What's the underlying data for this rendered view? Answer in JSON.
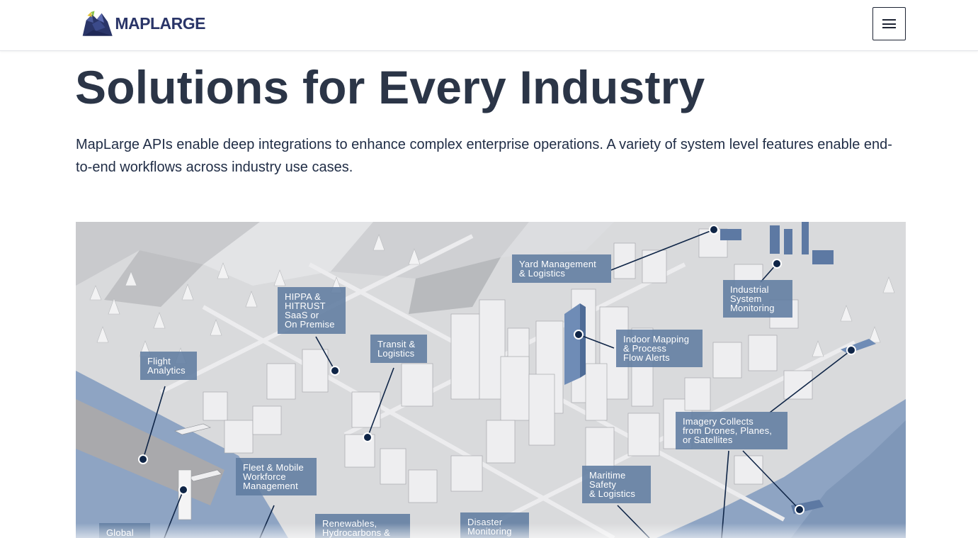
{
  "header": {
    "logo_text": "MAPLARGE",
    "menu_icon": "hamburger-menu-icon"
  },
  "main": {
    "title": "Solutions for Every Industry",
    "intro": "MapLarge APIs enable deep integrations to enhance complex enterprise operations. A variety of system level features enable end-to-end workflows across industry use cases."
  },
  "hero": {
    "callouts": {
      "yard": "Yard Management\n& Logistics",
      "industrial": "Industrial\nSystem\nMonitoring",
      "hippa": "HIPPA &\nHITRUST\nSaaS or\nOn Premise",
      "transit": "Transit &\nLogistics",
      "flight": "Flight\nAnalytics",
      "indoor": "Indoor Mapping\n& Process\nFlow Alerts",
      "imagery": "Imagery Collects\nfrom Drones, Planes,\nor Satellites",
      "fleet": "Fleet & Mobile\nWorkforce\nManagement",
      "maritime": "Maritime\nSafety\n& Logistics",
      "global": "Global",
      "renewables": "Renewables,\nHydrocarbons &",
      "disaster": "Disaster\nMonitoring"
    },
    "colors": {
      "water": "#8ea4c3",
      "marker": "#0f2547",
      "callout_bg": "#607ca0"
    }
  }
}
